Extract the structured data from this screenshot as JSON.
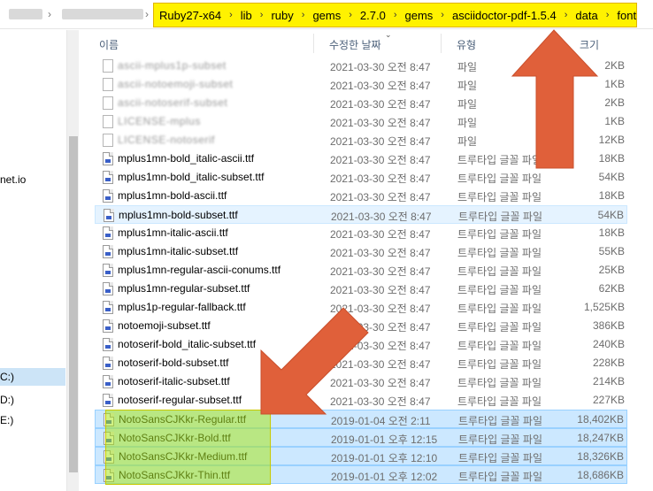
{
  "address_bar": {
    "crumbs": [
      "Ruby27-x64",
      "lib",
      "ruby",
      "gems",
      "2.7.0",
      "gems",
      "asciidoctor-pdf-1.5.4",
      "data",
      "fonts"
    ]
  },
  "nav": {
    "items": [
      {
        "label": "net.io",
        "selected": false
      },
      {
        "label": "C:)",
        "selected": true
      },
      {
        "label": "D:)",
        "selected": false
      },
      {
        "label": "E:)",
        "selected": false
      }
    ]
  },
  "columns": {
    "name": "이름",
    "date": "수정한 날짜",
    "type": "유형",
    "size": "크기"
  },
  "files": [
    {
      "name": "ascii-mplus1p-subset",
      "date": "2021-03-30 오전 8:47",
      "type": "파일",
      "size": "2KB",
      "icon": "blank-file-icon",
      "blurred": true,
      "state": ""
    },
    {
      "name": "ascii-notoemoji-subset",
      "date": "2021-03-30 오전 8:47",
      "type": "파일",
      "size": "1KB",
      "icon": "blank-file-icon",
      "blurred": true,
      "state": ""
    },
    {
      "name": "ascii-notoserif-subset",
      "date": "2021-03-30 오전 8:47",
      "type": "파일",
      "size": "2KB",
      "icon": "blank-file-icon",
      "blurred": true,
      "state": ""
    },
    {
      "name": "LICENSE-mplus",
      "date": "2021-03-30 오전 8:47",
      "type": "파일",
      "size": "1KB",
      "icon": "blank-file-icon",
      "blurred": true,
      "state": ""
    },
    {
      "name": "LICENSE-notoserif",
      "date": "2021-03-30 오전 8:47",
      "type": "파일",
      "size": "12KB",
      "icon": "blank-file-icon",
      "blurred": true,
      "state": ""
    },
    {
      "name": "mplus1mn-bold_italic-ascii.ttf",
      "date": "2021-03-30 오전 8:47",
      "type": "트루타입 글꼴 파일",
      "size": "18KB",
      "icon": "font-file-icon",
      "blurred": false,
      "state": ""
    },
    {
      "name": "mplus1mn-bold_italic-subset.ttf",
      "date": "2021-03-30 오전 8:47",
      "type": "트루타입 글꼴 파일",
      "size": "54KB",
      "icon": "font-file-icon",
      "blurred": false,
      "state": ""
    },
    {
      "name": "mplus1mn-bold-ascii.ttf",
      "date": "2021-03-30 오전 8:47",
      "type": "트루타입 글꼴 파일",
      "size": "18KB",
      "icon": "font-file-icon",
      "blurred": false,
      "state": ""
    },
    {
      "name": "mplus1mn-bold-subset.ttf",
      "date": "2021-03-30 오전 8:47",
      "type": "트루타입 글꼴 파일",
      "size": "54KB",
      "icon": "font-file-icon",
      "blurred": false,
      "state": "hl"
    },
    {
      "name": "mplus1mn-italic-ascii.ttf",
      "date": "2021-03-30 오전 8:47",
      "type": "트루타입 글꼴 파일",
      "size": "18KB",
      "icon": "font-file-icon",
      "blurred": false,
      "state": ""
    },
    {
      "name": "mplus1mn-italic-subset.ttf",
      "date": "2021-03-30 오전 8:47",
      "type": "트루타입 글꼴 파일",
      "size": "55KB",
      "icon": "font-file-icon",
      "blurred": false,
      "state": ""
    },
    {
      "name": "mplus1mn-regular-ascii-conums.ttf",
      "date": "2021-03-30 오전 8:47",
      "type": "트루타입 글꼴 파일",
      "size": "25KB",
      "icon": "font-file-icon",
      "blurred": false,
      "state": ""
    },
    {
      "name": "mplus1mn-regular-subset.ttf",
      "date": "2021-03-30 오전 8:47",
      "type": "트루타입 글꼴 파일",
      "size": "62KB",
      "icon": "font-file-icon",
      "blurred": false,
      "state": ""
    },
    {
      "name": "mplus1p-regular-fallback.ttf",
      "date": "2021-03-30 오전 8:47",
      "type": "트루타입 글꼴 파일",
      "size": "1,525KB",
      "icon": "font-file-icon",
      "blurred": false,
      "state": ""
    },
    {
      "name": "notoemoji-subset.ttf",
      "date": "2021-03-30 오전 8:47",
      "type": "트루타입 글꼴 파일",
      "size": "386KB",
      "icon": "font-file-icon",
      "blurred": false,
      "state": ""
    },
    {
      "name": "notoserif-bold_italic-subset.ttf",
      "date": "2021-03-30 오전 8:47",
      "type": "트루타입 글꼴 파일",
      "size": "240KB",
      "icon": "font-file-icon",
      "blurred": false,
      "state": ""
    },
    {
      "name": "notoserif-bold-subset.ttf",
      "date": "2021-03-30 오전 8:47",
      "type": "트루타입 글꼴 파일",
      "size": "228KB",
      "icon": "font-file-icon",
      "blurred": false,
      "state": ""
    },
    {
      "name": "notoserif-italic-subset.ttf",
      "date": "2021-03-30 오전 8:47",
      "type": "트루타입 글꼴 파일",
      "size": "214KB",
      "icon": "font-file-icon",
      "blurred": false,
      "state": ""
    },
    {
      "name": "notoserif-regular-subset.ttf",
      "date": "2021-03-30 오전 8:47",
      "type": "트루타입 글꼴 파일",
      "size": "227KB",
      "icon": "font-file-icon",
      "blurred": false,
      "state": ""
    },
    {
      "name": "NotoSansCJKkr-Regular.ttf",
      "date": "2019-01-04 오전 2:11",
      "type": "트루타입 글꼴 파일",
      "size": "18,402KB",
      "icon": "font-file-icon",
      "blurred": false,
      "state": "sel"
    },
    {
      "name": "NotoSansCJKkr-Bold.ttf",
      "date": "2019-01-01 오후 12:15",
      "type": "트루타입 글꼴 파일",
      "size": "18,247KB",
      "icon": "font-file-icon",
      "blurred": false,
      "state": "sel"
    },
    {
      "name": "NotoSansCJKkr-Medium.ttf",
      "date": "2019-01-01 오후 12:10",
      "type": "트루타입 글꼴 파일",
      "size": "18,326KB",
      "icon": "font-file-icon",
      "blurred": false,
      "state": "sel"
    },
    {
      "name": "NotoSansCJKkr-Thin.ttf",
      "date": "2019-01-01 오후 12:02",
      "type": "트루타입 글꼴 파일",
      "size": "18,686KB",
      "icon": "font-file-icon",
      "blurred": false,
      "state": "sel"
    }
  ],
  "colors": {
    "crumb_highlight": "#fff200",
    "arrow": "#e0603a",
    "selection_highlight": "#b7e31d"
  }
}
